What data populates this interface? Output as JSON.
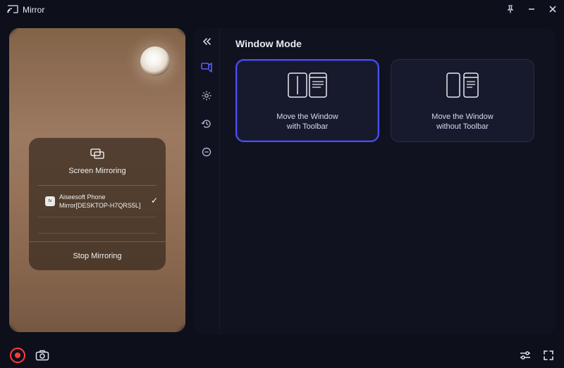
{
  "title": "Mirror",
  "phone": {
    "mirror_title": "Screen Mirroring",
    "device_name": "Aiseesoft Phone Mirror[DESKTOP-H7QRS5L]",
    "stop_label": "Stop Mirroring"
  },
  "panel": {
    "heading": "Window Mode",
    "card1": {
      "line1": "Move the Window",
      "line2": "with Toolbar"
    },
    "card2": {
      "line1": "Move the Window",
      "line2": "without Toolbar"
    }
  }
}
